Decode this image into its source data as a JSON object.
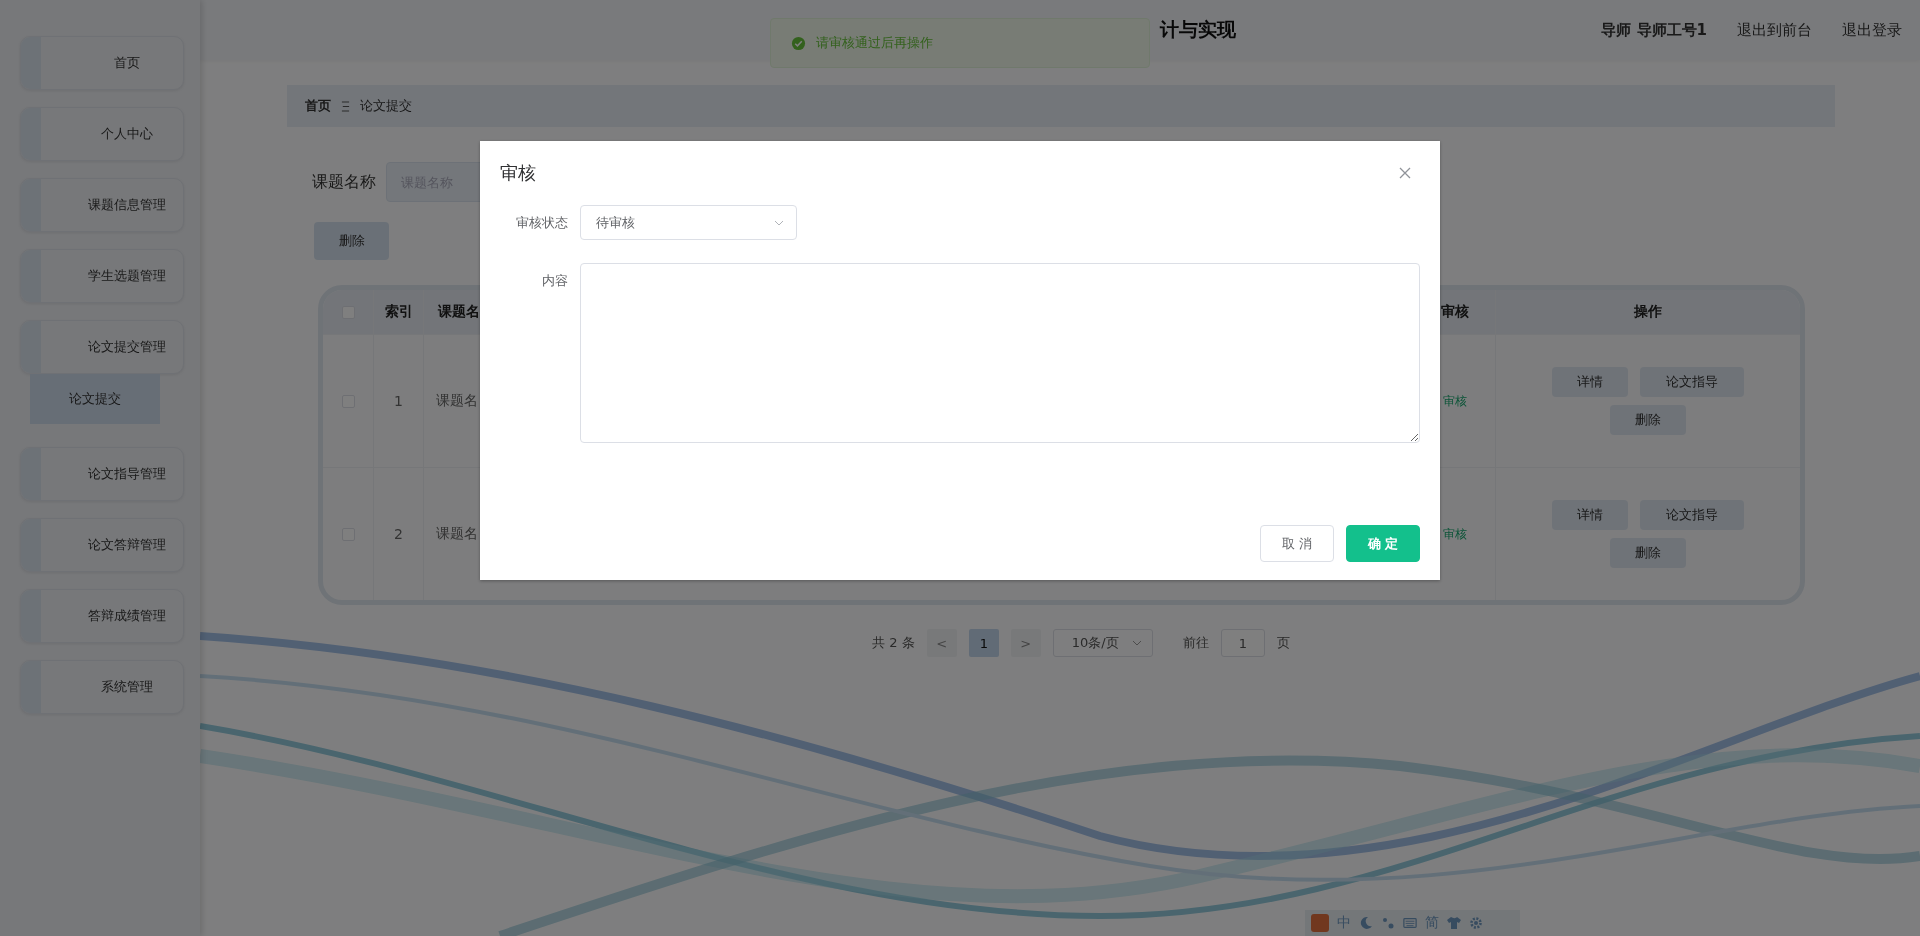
{
  "sidebar": {
    "items": [
      {
        "label": "首页"
      },
      {
        "label": "个人中心"
      },
      {
        "label": "课题信息管理"
      },
      {
        "label": "学生选题管理"
      },
      {
        "label": "论文提交管理",
        "children": [
          {
            "label": "论文提交",
            "selected": true
          }
        ]
      },
      {
        "label": "论文指导管理"
      },
      {
        "label": "论文答辩管理"
      },
      {
        "label": "答辩成绩管理"
      },
      {
        "label": "系统管理"
      }
    ]
  },
  "header": {
    "title": "计与实现",
    "user": "导师 导师工号1",
    "links": [
      "退出到前台",
      "退出登录"
    ]
  },
  "toast": {
    "message": "请审核通过后再操作"
  },
  "breadcrumb": [
    "首页",
    "论文提交"
  ],
  "search": {
    "label": "课题名称",
    "placeholder": "课题名称"
  },
  "toolbar_buttons": [
    "删除"
  ],
  "table": {
    "all_checked": false,
    "columns": [
      "索引",
      "课题名",
      "审核",
      "操作"
    ],
    "rows": [
      {
        "checked": false,
        "index": "1",
        "title": "课题名",
        "status": "审核",
        "actions": [
          "详情",
          "论文指导",
          "删除"
        ]
      },
      {
        "checked": false,
        "index": "2",
        "title": "课题名",
        "status": "审核",
        "actions": [
          "详情",
          "论文指导",
          "删除"
        ]
      }
    ]
  },
  "pagination": {
    "total": "共 2 条",
    "prev": "<",
    "next": ">",
    "pages": [
      {
        "label": "1",
        "selected": true
      }
    ],
    "page_size": "10条/页",
    "goto_label": "前往",
    "goto_value": "1",
    "goto_suffix": "页"
  },
  "dialog": {
    "title": "审核",
    "fields": [
      {
        "kind": "select",
        "label": "审核状态",
        "value": "待审核"
      },
      {
        "kind": "textarea",
        "label": "内容"
      }
    ],
    "buttons": [
      {
        "kind": "default",
        "label": "取 消"
      },
      {
        "kind": "primary",
        "label": "确 定"
      }
    ]
  },
  "ime": {
    "mode": "中",
    "script": "简"
  }
}
